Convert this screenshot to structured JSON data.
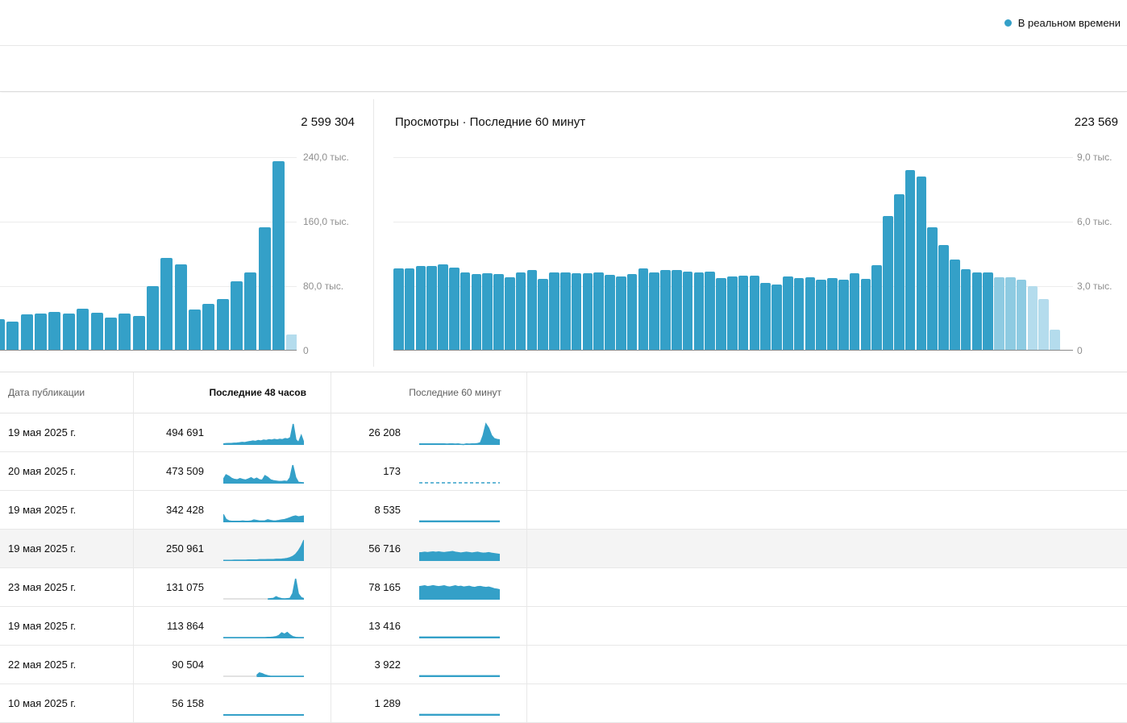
{
  "topbar": {
    "realtime_label": "В реальном времени"
  },
  "colors": {
    "accent_teal": "#34a0c8",
    "bar_light_mid": "#8ecbe2",
    "bar_light_pale": "#b4dced",
    "nodata_gray": "#d9d9d9",
    "row_highlight": "#f4f4f4"
  },
  "charts": {
    "left": {
      "total": "2 599 304",
      "y_ticks": [
        "240,0 тыс.",
        "160,0 тыс.",
        "80,0 тыс.",
        "0"
      ],
      "light_last_n": 1
    },
    "right": {
      "title": "Просмотры · Последние 60 минут",
      "total": "223 569",
      "y_ticks": [
        "9,0 тыс.",
        "6,0 тыс.",
        "3,0 тыс.",
        "0"
      ],
      "light_last_n": 6
    }
  },
  "chart_data": [
    {
      "type": "bar",
      "title": "Последние 48 часов (hourly views, partial view)",
      "ylabel": "Просмотры",
      "ylim": [
        0,
        260000
      ],
      "gridlines": [
        240000,
        160000,
        80000,
        0
      ],
      "values": [
        38000,
        35000,
        44000,
        45000,
        47000,
        45000,
        51000,
        46000,
        40000,
        45000,
        42000,
        79000,
        114000,
        106000,
        50000,
        57000,
        63000,
        85000,
        96000,
        152000,
        234000,
        19000
      ],
      "total": 2599304
    },
    {
      "type": "bar",
      "title": "Просмотры · Последние 60 минут",
      "ylabel": "Просмотры",
      "ylim": [
        0,
        9300
      ],
      "gridlines": [
        9000,
        6000,
        3000,
        0
      ],
      "values": [
        3780,
        3780,
        3890,
        3890,
        3960,
        3830,
        3620,
        3510,
        3570,
        3510,
        3360,
        3610,
        3710,
        3310,
        3590,
        3610,
        3560,
        3560,
        3610,
        3480,
        3430,
        3510,
        3780,
        3620,
        3710,
        3710,
        3650,
        3610,
        3650,
        3350,
        3420,
        3450,
        3450,
        3120,
        3050,
        3400,
        3350,
        3360,
        3270,
        3350,
        3250,
        3570,
        3310,
        3930,
        6220,
        7240,
        8370,
        8080,
        5700,
        4870,
        4220,
        3750,
        3600,
        3600,
        3360,
        3360,
        3260,
        2960,
        2360,
        940
      ],
      "total": 223569
    }
  ],
  "table": {
    "columns": [
      "Дата публикации",
      "Последние 48 часов",
      "Последние 60 минут"
    ],
    "rows": [
      {
        "date": "19 мая 2025 г.",
        "h48": "494 691",
        "m60": "26 208",
        "highlighted": false,
        "spark48": {
          "v": [
            0.05,
            0.06,
            0.07,
            0.07,
            0.08,
            0.09,
            0.1,
            0.12,
            0.11,
            0.14,
            0.16,
            0.19,
            0.17,
            0.21,
            0.19,
            0.23,
            0.21,
            0.25,
            0.23,
            0.26,
            0.24,
            0.27,
            0.25,
            0.3,
            0.28,
            0.35,
            1.0,
            0.25,
            0.12,
            0.45,
            0.1
          ]
        },
        "spark60": {
          "v": [
            0.05,
            0.05,
            0.05,
            0.05,
            0.05,
            0.05,
            0.05,
            0.05,
            0.05,
            0.05,
            0.04,
            0.05,
            0.05,
            0.04,
            0.05,
            0.03,
            0.02,
            0.05,
            0.04,
            0.05,
            0.05,
            0.06,
            0.1,
            0.45,
            1.0,
            0.8,
            0.45,
            0.3,
            0.26,
            0.24
          ]
        }
      },
      {
        "date": "20 мая 2025 г.",
        "h48": "473 509",
        "m60": "173",
        "highlighted": false,
        "spark48": {
          "v": [
            0.2,
            0.42,
            0.35,
            0.25,
            0.2,
            0.18,
            0.24,
            0.2,
            0.17,
            0.22,
            0.28,
            0.2,
            0.26,
            0.18,
            0.16,
            0.38,
            0.3,
            0.18,
            0.14,
            0.12,
            0.1,
            0.1,
            0.12,
            0.1,
            0.28,
            0.88,
            0.3,
            0.06,
            0.05,
            0.04
          ]
        },
        "spark60": {
          "dashed": true
        }
      },
      {
        "date": "19 мая 2025 г.",
        "h48": "342 428",
        "m60": "8 535",
        "highlighted": false,
        "spark48": {
          "v": [
            0.38,
            0.14,
            0.07,
            0.05,
            0.05,
            0.05,
            0.05,
            0.06,
            0.05,
            0.05,
            0.06,
            0.11,
            0.09,
            0.06,
            0.06,
            0.07,
            0.12,
            0.09,
            0.06,
            0.07,
            0.09,
            0.11,
            0.13,
            0.17,
            0.22,
            0.27,
            0.3,
            0.26,
            0.28,
            0.3
          ]
        },
        "spark60": {
          "flat": 0.06
        }
      },
      {
        "date": "19 мая 2025 г.",
        "h48": "250 961",
        "m60": "56 716",
        "highlighted": true,
        "spark48": {
          "v": [
            0.03,
            0.03,
            0.03,
            0.03,
            0.04,
            0.04,
            0.04,
            0.04,
            0.04,
            0.05,
            0.05,
            0.05,
            0.05,
            0.06,
            0.06,
            0.06,
            0.07,
            0.07,
            0.07,
            0.08,
            0.08,
            0.09,
            0.1,
            0.12,
            0.16,
            0.22,
            0.32,
            0.48,
            0.7,
            1.0
          ]
        },
        "spark60": {
          "v": [
            0.39,
            0.4,
            0.42,
            0.4,
            0.42,
            0.43,
            0.41,
            0.43,
            0.41,
            0.4,
            0.42,
            0.43,
            0.45,
            0.42,
            0.4,
            0.38,
            0.4,
            0.42,
            0.4,
            0.38,
            0.4,
            0.42,
            0.39,
            0.37,
            0.38,
            0.4,
            0.37,
            0.35,
            0.33,
            0.31
          ]
        }
      },
      {
        "date": "23 мая 2025 г.",
        "h48": "131 075",
        "m60": "78 165",
        "highlighted": false,
        "spark48": {
          "gray_until": 0.53,
          "v": [
            0.03,
            0.03,
            0.03,
            0.03,
            0.03,
            0.03,
            0.03,
            0.03,
            0.03,
            0.03,
            0.03,
            0.03,
            0.03,
            0.03,
            0.03,
            0.03,
            0.04,
            0.05,
            0.06,
            0.14,
            0.08,
            0.05,
            0.04,
            0.05,
            0.06,
            0.3,
            1.0,
            0.28,
            0.1,
            0.05
          ]
        },
        "spark60": {
          "v": [
            0.62,
            0.64,
            0.66,
            0.62,
            0.64,
            0.67,
            0.64,
            0.62,
            0.64,
            0.66,
            0.62,
            0.6,
            0.63,
            0.66,
            0.62,
            0.64,
            0.6,
            0.62,
            0.64,
            0.6,
            0.58,
            0.62,
            0.63,
            0.6,
            0.58,
            0.6,
            0.56,
            0.52,
            0.5,
            0.47
          ]
        }
      },
      {
        "date": "19 мая 2025 г.",
        "h48": "113 864",
        "m60": "13 416",
        "highlighted": false,
        "spark48": {
          "v": [
            0.04,
            0.04,
            0.04,
            0.04,
            0.04,
            0.04,
            0.04,
            0.04,
            0.04,
            0.04,
            0.04,
            0.04,
            0.04,
            0.04,
            0.04,
            0.04,
            0.05,
            0.05,
            0.06,
            0.08,
            0.14,
            0.26,
            0.2,
            0.28,
            0.16,
            0.08,
            0.05,
            0.04,
            0.04,
            0.04
          ]
        },
        "spark60": {
          "flat": 0.06
        }
      },
      {
        "date": "22 мая 2025 г.",
        "h48": "90 504",
        "m60": "3 922",
        "highlighted": false,
        "spark48": {
          "gray_until": 0.4,
          "v": [
            0.03,
            0.03,
            0.03,
            0.03,
            0.03,
            0.03,
            0.03,
            0.03,
            0.03,
            0.03,
            0.03,
            0.03,
            0.08,
            0.2,
            0.16,
            0.1,
            0.06,
            0.04,
            0.04,
            0.04,
            0.04,
            0.04,
            0.04,
            0.04,
            0.04,
            0.04,
            0.04,
            0.04,
            0.04,
            0.04
          ]
        },
        "spark60": {
          "flat": 0.06
        }
      },
      {
        "date": "10 мая 2025 г.",
        "h48": "56 158",
        "m60": "1 289",
        "highlighted": false,
        "spark48": {
          "flat": 0.05
        },
        "spark60": {
          "flat": 0.06
        }
      }
    ]
  }
}
